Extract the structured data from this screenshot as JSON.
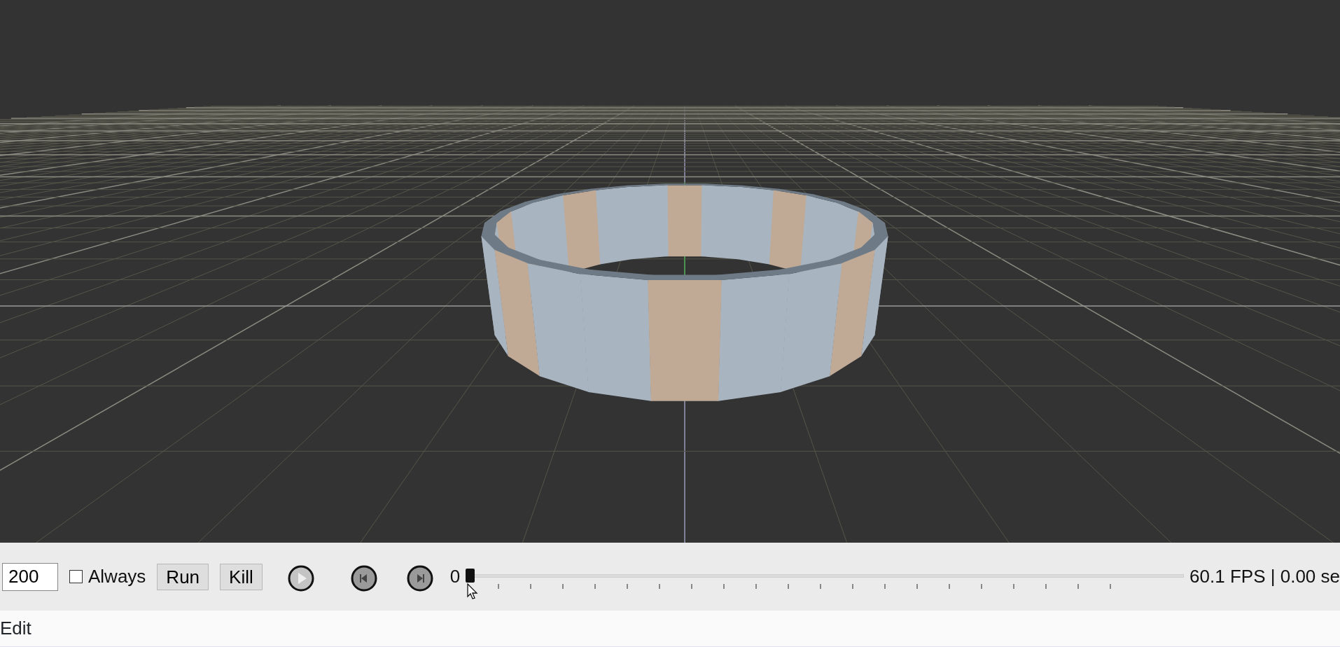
{
  "toolbar": {
    "steps_field": {
      "value": "200"
    },
    "always_checkbox": {
      "label": "Always",
      "checked": false
    },
    "buttons": [
      "Run",
      "Kill"
    ],
    "timeline": {
      "position_label": "0",
      "level": 0
    },
    "status": "60.1 FPS | 0.00 se"
  },
  "menu": [
    "Edit"
  ]
}
